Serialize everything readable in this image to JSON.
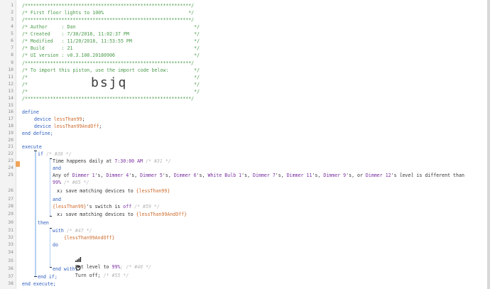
{
  "line_numbers": [
    "1",
    "2",
    "3",
    "4",
    "5",
    "6",
    "7",
    "8",
    "9",
    "10",
    "11",
    "12",
    "13",
    "14",
    "15",
    "16",
    "17",
    "18",
    "19",
    "20",
    "21",
    "22",
    "23",
    "24",
    "25",
    "26",
    "27",
    "28",
    "29",
    "30",
    "31",
    "32",
    "33",
    "34",
    "35",
    "36",
    "37",
    "38"
  ],
  "header": {
    "star_line": "/***********************************************************/",
    "title_line": "/* First floor lights to 100%                              */",
    "author_line": "/* Author     : Dan                                          */",
    "created_line": "/* Created    : 7/30/2018, 11:02:37 PM                       */",
    "modified_line": "/* Modified   : 11/20/2018, 11:53:55 PM                      */",
    "build_line": "/* Build      : 21                                           */",
    "ui_line": "/* UI version : v0.3.108.20180906                            */",
    "import_line": "/* To import this piston, use the import code below:         */",
    "blank_line": "/*                                                           */",
    "import_code": "bsjq"
  },
  "code": {
    "define": "define",
    "device_kw": "device",
    "var1": "lessThan99",
    "var2": "lessThan99AndOff",
    "semicolon": ";",
    "end_define": "end define;",
    "execute": "execute",
    "if_kw": "if",
    "if_comment": "/* #38 */",
    "time_text": "Time",
    "happens_daily_at": " happens daily at ",
    "time_value": "7:30:00 AM",
    "time_comment": " /* #31 */",
    "and1": "and",
    "any_of": "Any of ",
    "devices": [
      "Dimmer 1",
      "Dimmer 4",
      "Dimmer 5",
      "Dimmer 6",
      "White Bulb 1",
      "Dimmer 7",
      "Dimmer 11",
      "Dimmer 9",
      "Dimmer 12"
    ],
    "possessive": "'s",
    "sep": ", ",
    "or_word": ", or ",
    "level_word": "level",
    "is_different_than": " is different than",
    "level_value": "99%",
    "level_comment": " /* #65 */",
    "save_matching": "save matching devices to ",
    "save_target1": "{lessThan99}",
    "and2": "and",
    "var_ref": "{lessThan99}",
    "switch_is": "'s switch is ",
    "off_value": "off",
    "off_comment": " /* #59 */",
    "save_target2": "{lessThan99AndOff}",
    "then": "then",
    "with_kw": "with",
    "with_comment": " /* #47 */",
    "with_target": "{lessThan99AndOff}",
    "do_kw": "do",
    "set_level": "Set level to ",
    "set_level_value": "99%",
    "set_level_comment": "; /* #48 */",
    "turn_off": "Turn off;",
    "turn_off_comment": " /* #55 */",
    "end_with": "end with;",
    "end_if": "end if;",
    "end_execute": "end execute;"
  },
  "icons": {
    "filter_icon": "x₂",
    "signal_icon": "signal-bars",
    "power_icon": "power"
  },
  "colors": {
    "comment": "#4a9a4a",
    "keyword": "#2b5bbf",
    "variable": "#cc6a2b",
    "value": "#7a2fa0",
    "marker": "#f0a45a"
  }
}
